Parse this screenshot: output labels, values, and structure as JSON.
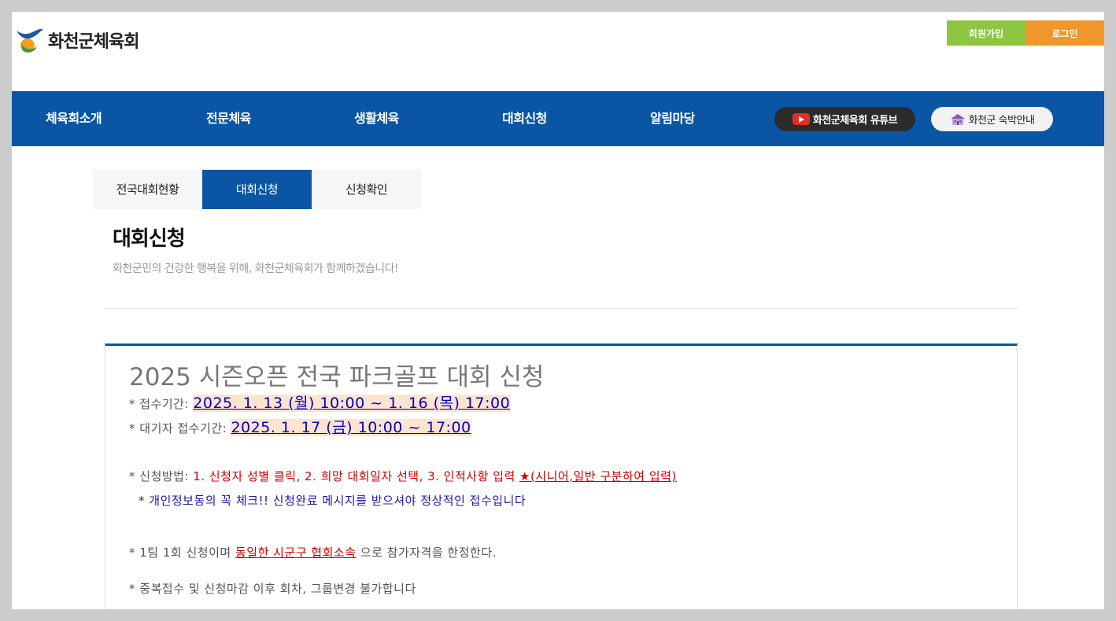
{
  "header": {
    "logo_text": "화천군체육회",
    "join_label": "회원가입",
    "login_label": "로그인"
  },
  "nav": {
    "items": [
      "체육회소개",
      "전문체육",
      "생활체육",
      "대회신청",
      "알림마당"
    ],
    "youtube_label": "화천군체육회 유튜브",
    "stay_label": "화천군 숙박안내"
  },
  "subtabs": [
    {
      "label": "전국대회현황",
      "active": false
    },
    {
      "label": "대회신청",
      "active": true
    },
    {
      "label": "신청확인",
      "active": false
    }
  ],
  "page": {
    "title": "대회신청",
    "subtitle": "화천군민의 건강한 행복을 위해, 화천군체육회가 함께하겠습니다!"
  },
  "notice": {
    "title": "2025 시즌오픈 전국 파크골프  대회 신청",
    "period_label": "* 접수기간: ",
    "period_value": "2025. 1. 13 (월) 10:00 ~ 1. 16 (목) 17:00",
    "wait_label": "*  대기자 접수기간: ",
    "wait_value": "2025. 1. 17 (금) 10:00 ~ 17:00",
    "method_label": "* 신청방법: ",
    "method_value": "1. 신청자 성별 클릭,  2. 희망 대회일자 선택, 3. 인적사항 입력  ",
    "method_note": "★(시니어,일반 구분하여 입력)",
    "privacy_note": "* 개인정보동의 꼭 체크!! 신청완료 메시지를 받으셔야 정상적인 접수입니다",
    "team_prefix": "* 1팀  1회 신청이며 ",
    "team_highlight": "동일한 시군구 협회소속",
    "team_suffix": "  으로 참가자격을 한정한다.",
    "duplicate_note": "*  중복접수 및 신청마감 이후 회차, 그룹변경 불가합니다"
  },
  "colors": {
    "brand_blue": "#0a56a4",
    "join_green": "#8dc63f",
    "login_orange": "#f0962a"
  }
}
